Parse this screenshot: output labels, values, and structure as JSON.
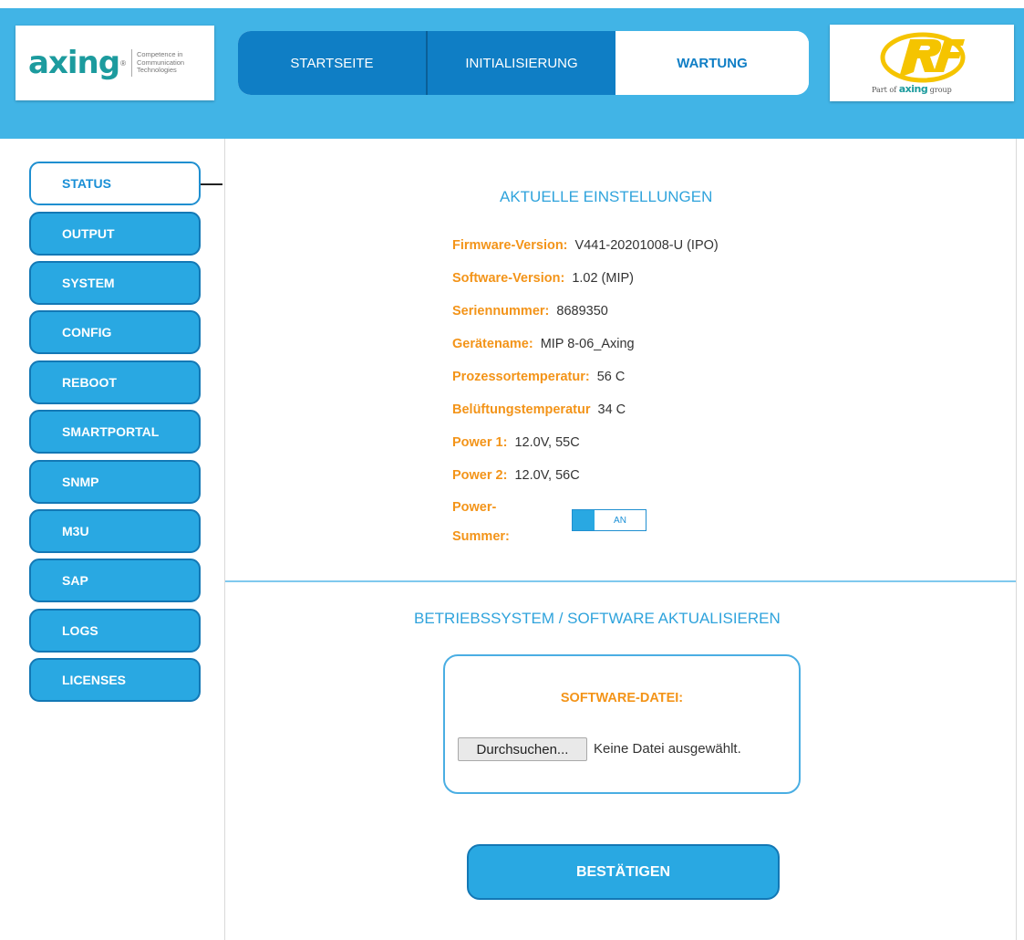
{
  "brand": {
    "left_logo_text": "axing",
    "left_logo_reg": "®",
    "tagline": "Competence in Communication Technologies",
    "right_logo_text": "RF",
    "right_logo_part_of": "Part of",
    "right_logo_group_name": "axing",
    "right_logo_group": "group",
    "teal": "#1c9b9e",
    "rf_yellow": "#f5c400"
  },
  "nav": {
    "tabs": [
      {
        "label": "STARTSEITE",
        "active": false
      },
      {
        "label": "INITIALISIERUNG",
        "active": false
      },
      {
        "label": "WARTUNG",
        "active": true
      }
    ]
  },
  "sidebar": {
    "items": [
      {
        "label": "STATUS",
        "active": true
      },
      {
        "label": "OUTPUT"
      },
      {
        "label": "SYSTEM"
      },
      {
        "label": "CONFIG"
      },
      {
        "label": "REBOOT"
      },
      {
        "label": "SMARTPORTAL"
      },
      {
        "label": "SNMP"
      },
      {
        "label": "M3U"
      },
      {
        "label": "SAP"
      },
      {
        "label": "LOGS"
      },
      {
        "label": "LICENSES"
      }
    ]
  },
  "status": {
    "title": "AKTUELLE EINSTELLUNGEN",
    "rows": [
      {
        "label": "Firmware-Version:",
        "value": "V441-20201008-U (IPO)"
      },
      {
        "label": "Software-Version:",
        "value": "1.02 (MIP)"
      },
      {
        "label": "Seriennummer:",
        "value": "8689350"
      },
      {
        "label": "Gerätename:",
        "value": "MIP 8-06_Axing"
      },
      {
        "label": "Prozessortemperatur:",
        "value": "56 C"
      },
      {
        "label": "Belüftungstemperatur",
        "value": "34 C"
      },
      {
        "label": "Power 1:",
        "value": "12.0V, 55C"
      },
      {
        "label": "Power 2:",
        "value": "12.0V, 56C"
      }
    ],
    "buzzer_label_1": "Power-",
    "buzzer_label_2": "Summer:",
    "buzzer_state": "AN"
  },
  "update": {
    "title": "BETRIEBSSYSTEM / SOFTWARE AKTUALISIEREN",
    "file_label": "SOFTWARE-DATEI:",
    "browse_label": "Durchsuchen...",
    "no_file_text": "Keine Datei ausgewählt.",
    "confirm_label": "BESTÄTIGEN"
  },
  "colors": {
    "header_blue": "#41b4e6",
    "nav_blue": "#0f7ec5",
    "button_blue": "#29a8e2",
    "label_orange": "#f39419",
    "title_blue": "#2fa3dc"
  }
}
